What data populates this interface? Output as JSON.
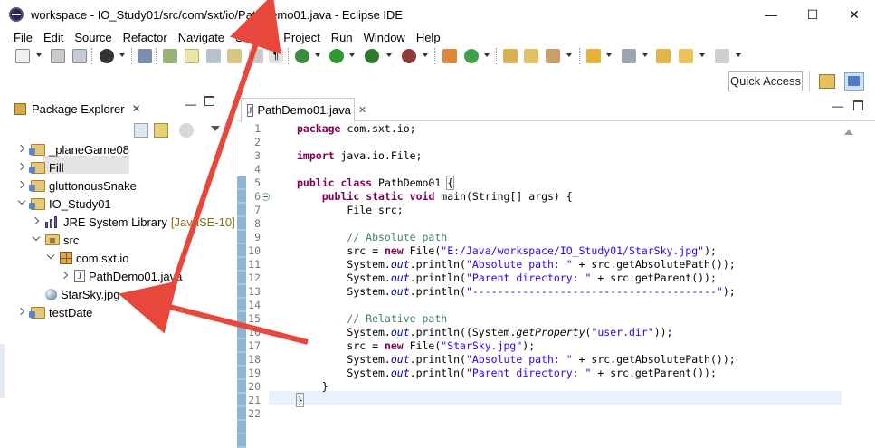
{
  "window": {
    "title": "workspace - IO_Study01/src/com/sxt/io/PathDemo01.java - Eclipse IDE",
    "minimize": "—",
    "maximize": "☐",
    "close": "✕"
  },
  "menu": [
    "File",
    "Edit",
    "Source",
    "Refactor",
    "Navigate",
    "Search",
    "Project",
    "Run",
    "Window",
    "Help"
  ],
  "toolbar": {
    "quick_access": "Quick Access"
  },
  "package_explorer": {
    "title": "Package Explorer",
    "close": "✕",
    "minimize": "—",
    "tree": [
      {
        "label": "_planeGame08"
      },
      {
        "label": "Fill"
      },
      {
        "label": "gluttonousSnake"
      },
      {
        "label": "IO_Study01"
      },
      {
        "label": "JRE System Library",
        "version": "[JavaSE-10]"
      },
      {
        "label": "src"
      },
      {
        "label": "com.sxt.io"
      },
      {
        "label": "PathDemo01.java"
      },
      {
        "label": "StarSky.jpg"
      },
      {
        "label": "testDate"
      }
    ]
  },
  "editor": {
    "tab_label": "PathDemo01.java",
    "tab_close": "✕",
    "minimize": "—",
    "icon_letter": "J",
    "line_numbers": [
      "1",
      "2",
      "3",
      "4",
      "5",
      "6",
      "7",
      "8",
      "9",
      "10",
      "11",
      "12",
      "13",
      "14",
      "15",
      "16",
      "17",
      "18",
      "19",
      "20",
      "21",
      "22"
    ],
    "code": {
      "l1_kw": "package",
      "l1_rest": " com.sxt.io;",
      "l3_kw": "import",
      "l3_rest": " java.io.File;",
      "l5_kw1": "public",
      "l5_kw2": "class",
      "l5_name": " PathDemo01 ",
      "l5_brace": "{",
      "l6_kw1": "public",
      "l6_kw2": "static",
      "l6_kw3": "void",
      "l6_rest": " main(String[] args) {",
      "l7": "File src;",
      "l9": "// Absolute path",
      "l10_a": "src = ",
      "l10_kw": "new",
      "l10_b": " File(",
      "l10_str": "\"E:/Java/workspace/IO_Study01/StarSky.jpg\"",
      "l10_c": ");",
      "sys": "System.",
      "out": "out",
      "println": ".println(",
      "l11_str": "\"Absolute path: \"",
      "l11_rest": " + src.getAbsolutePath());",
      "l12_str": "\"Parent directory: \"",
      "l12_rest": " + src.getParent());",
      "l13_str": "\"---------------------------------------\"",
      "l13_rest": ");",
      "l15": "// Relative path",
      "l16_a": "(System.",
      "l16_b": "getProperty",
      "l16_str": "\"user.dir\"",
      "l16_rest": "));",
      "l17_str": "\"StarSky.jpg\"",
      "l20": "}",
      "l21": "}"
    }
  }
}
